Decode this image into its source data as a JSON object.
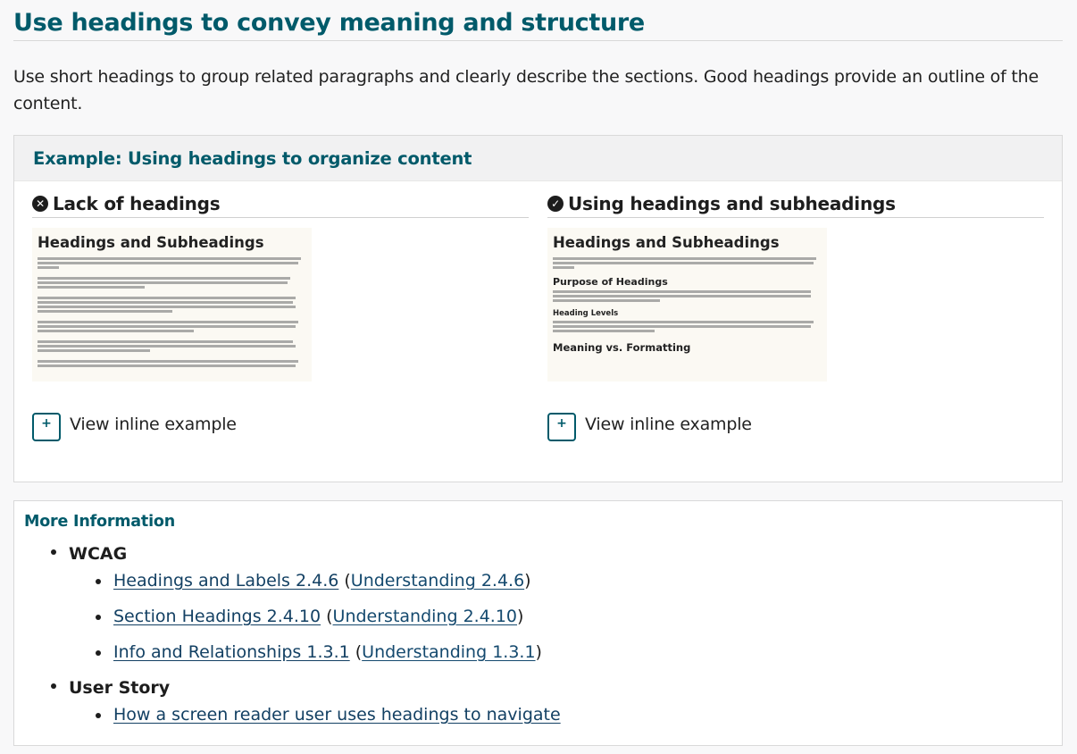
{
  "page": {
    "title": "Use headings to convey meaning and structure",
    "intro": "Use short headings to group related paragraphs and clearly describe the sections. Good headings provide an outline of the content."
  },
  "example": {
    "heading": "Example: Using headings to organize content",
    "left": {
      "title": "Lack of headings",
      "status_icon": "x-circle-icon",
      "thumb_title": "Headings and Subheadings",
      "button_label": "View inline example"
    },
    "right": {
      "title": "Using headings and subheadings",
      "status_icon": "check-circle-icon",
      "thumb_title": "Headings and Subheadings",
      "thumb_sub1": "Purpose of Headings",
      "thumb_sub2": "Heading Levels",
      "thumb_sub3": "Meaning vs. Formatting",
      "button_label": "View inline example"
    }
  },
  "more_info": {
    "title": "More Information",
    "groups": [
      {
        "label": "WCAG",
        "items": [
          {
            "link": "Headings and Labels 2.4.6",
            "understanding": "Understanding 2.4.6"
          },
          {
            "link": "Section Headings 2.4.10",
            "understanding": "Understanding 2.4.10"
          },
          {
            "link": "Info and Relationships 1.3.1",
            "understanding": "Understanding 1.3.1"
          }
        ]
      },
      {
        "label": "User Story",
        "items": [
          {
            "link": "How a screen reader user uses headings to navigate"
          }
        ]
      }
    ]
  },
  "colors": {
    "accent": "#005a6a",
    "link": "#134063",
    "background": "#f8f8f9"
  }
}
